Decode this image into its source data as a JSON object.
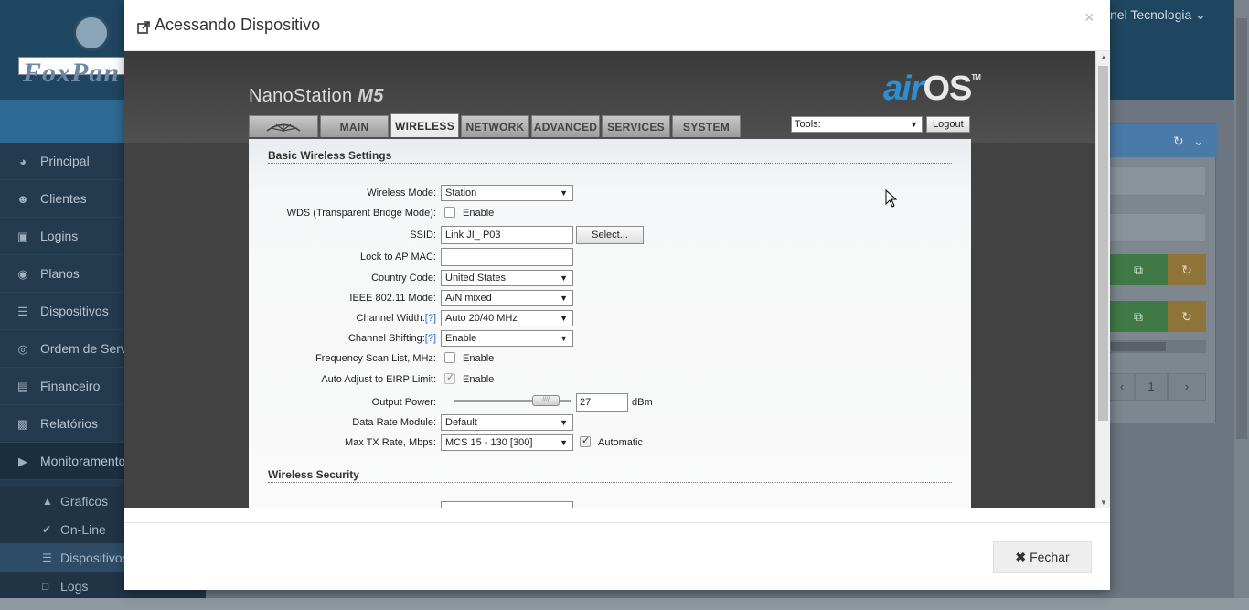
{
  "background": {
    "logo_text": "FoxPan",
    "user_menu": "nel Tecnologia",
    "sidebar": {
      "items": [
        {
          "label": "Principal",
          "icon": "dashboard-icon"
        },
        {
          "label": "Clientes",
          "icon": "users-icon"
        },
        {
          "label": "Logins",
          "icon": "laptop-icon"
        },
        {
          "label": "Planos",
          "icon": "globe-icon"
        },
        {
          "label": "Dispositivos",
          "icon": "server-icon"
        },
        {
          "label": "Ordem de Serv",
          "icon": "support-icon"
        },
        {
          "label": "Financeiro",
          "icon": "money-icon"
        },
        {
          "label": "Relatórios",
          "icon": "bar-chart-icon"
        },
        {
          "label": "Monitoramento",
          "icon": "video-camera-icon"
        }
      ],
      "subitems": [
        {
          "label": "Graficos",
          "icon": "area-chart-icon"
        },
        {
          "label": "On-Line",
          "icon": "check-circle-icon"
        },
        {
          "label": "Dispositivos",
          "icon": "list-icon"
        },
        {
          "label": "Logs",
          "icon": "file-icon"
        }
      ]
    },
    "pager": {
      "prev": "‹",
      "page": "1",
      "next": "›"
    }
  },
  "modal": {
    "title": "Acessando Dispositivo",
    "close_symbol": "×",
    "footer_button": "Fechar"
  },
  "airos": {
    "device_name": "NanoStation",
    "device_model": "M5",
    "logo_air": "air",
    "logo_os": "OS",
    "logo_tm": "TM",
    "tabs": [
      "MAIN",
      "WIRELESS",
      "NETWORK",
      "ADVANCED",
      "SERVICES",
      "SYSTEM"
    ],
    "active_tab": "WIRELESS",
    "tools_label": "Tools:",
    "logout_label": "Logout",
    "section_basic": "Basic Wireless Settings",
    "section_security": "Wireless Security",
    "help_link": "[?]",
    "fields": {
      "wireless_mode": {
        "label": "Wireless Mode:",
        "value": "Station"
      },
      "wds": {
        "label": "WDS (Transparent Bridge Mode):",
        "checkbox_label": "Enable",
        "checked": false
      },
      "ssid": {
        "label": "SSID:",
        "value": "Link JI_ P03",
        "button": "Select..."
      },
      "lock_ap_mac": {
        "label": "Lock to AP MAC:",
        "value": ""
      },
      "country_code": {
        "label": "Country Code:",
        "value": "United States"
      },
      "ieee_mode": {
        "label": "IEEE 802.11 Mode:",
        "value": "A/N mixed"
      },
      "channel_width": {
        "label": "Channel Width:",
        "value": "Auto 20/40 MHz"
      },
      "channel_shifting": {
        "label": "Channel Shifting:",
        "value": "Enable"
      },
      "freq_scan": {
        "label": "Frequency Scan List, MHz:",
        "checkbox_label": "Enable",
        "checked": false
      },
      "auto_eirp": {
        "label": "Auto Adjust to EIRP Limit:",
        "checkbox_label": "Enable",
        "checked": true
      },
      "output_power": {
        "label": "Output Power:",
        "value": "27",
        "unit": "dBm",
        "slider_fraction": 0.88
      },
      "data_rate": {
        "label": "Data Rate Module:",
        "value": "Default"
      },
      "max_tx": {
        "label": "Max TX Rate, Mbps:",
        "value": "MCS 15 - 130 [300]",
        "checkbox_label": "Automatic",
        "checked": true
      }
    }
  }
}
